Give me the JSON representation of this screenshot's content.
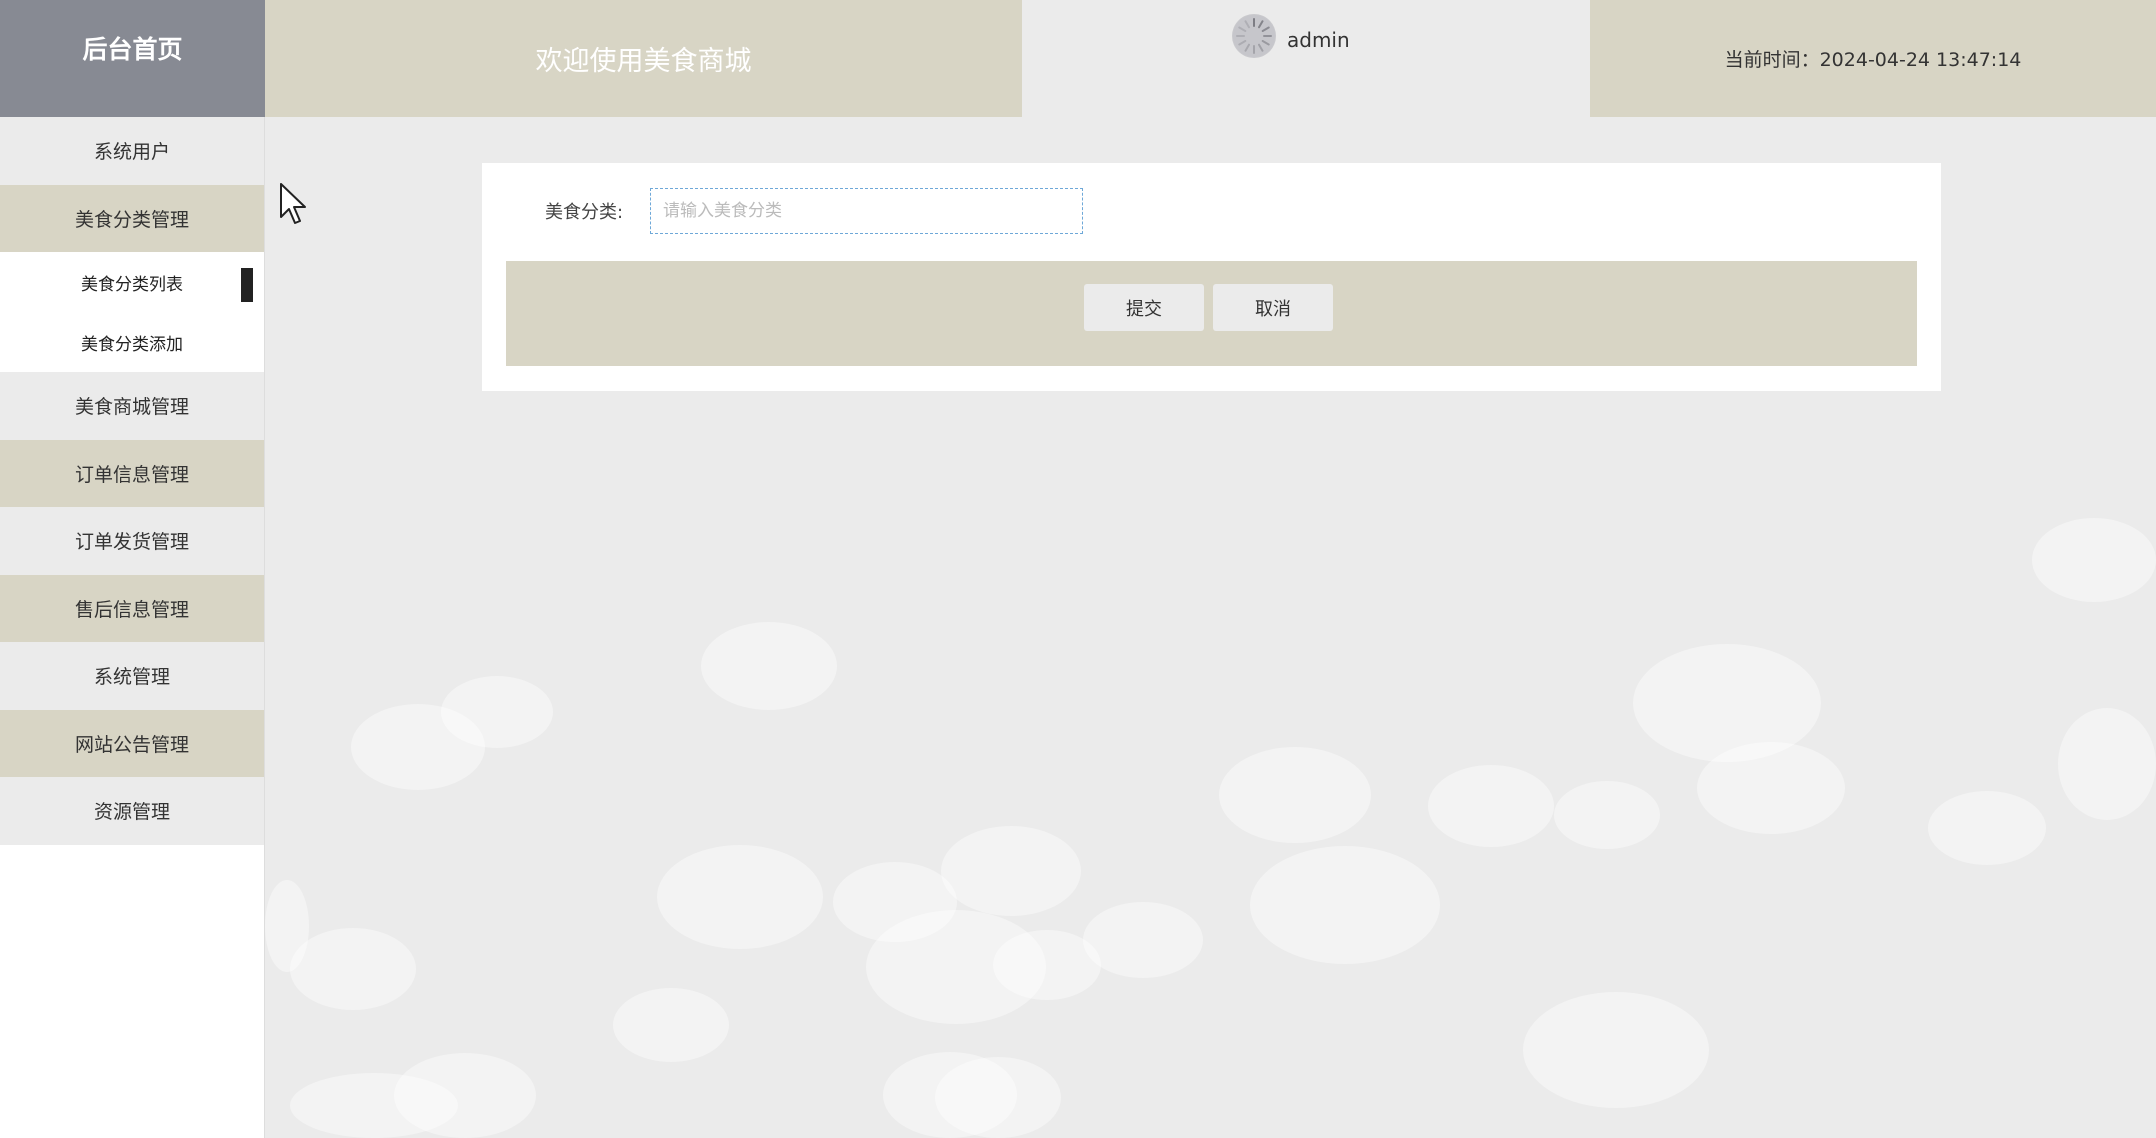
{
  "header": {
    "brand": "后台首页",
    "welcome": "欢迎使用美食商城",
    "username": "admin",
    "time_text": "当前时间：2024-04-24 13:47:14"
  },
  "sidebar": {
    "items": [
      {
        "label": "系统用户"
      },
      {
        "label": "美食分类管理"
      },
      {
        "label": "美食商城管理"
      },
      {
        "label": "订单信息管理"
      },
      {
        "label": "订单发货管理"
      },
      {
        "label": "售后信息管理"
      },
      {
        "label": "系统管理"
      },
      {
        "label": "网站公告管理"
      },
      {
        "label": "资源管理"
      }
    ],
    "subitems": [
      {
        "label": "美食分类列表",
        "active": true
      },
      {
        "label": "美食分类添加",
        "active": false
      }
    ]
  },
  "form": {
    "category_label": "美食分类:",
    "category_placeholder": "请输入美食分类",
    "category_value": "",
    "submit_label": "提交",
    "cancel_label": "取消"
  },
  "colors": {
    "brand_bg": "#878a93",
    "tan": "#d8d5c5",
    "light_gray": "#ebebeb",
    "input_border": "#6ea8d8"
  },
  "icons": {
    "avatar": "loading-spinner-avatar-icon",
    "cursor": "mouse-pointer-icon"
  }
}
